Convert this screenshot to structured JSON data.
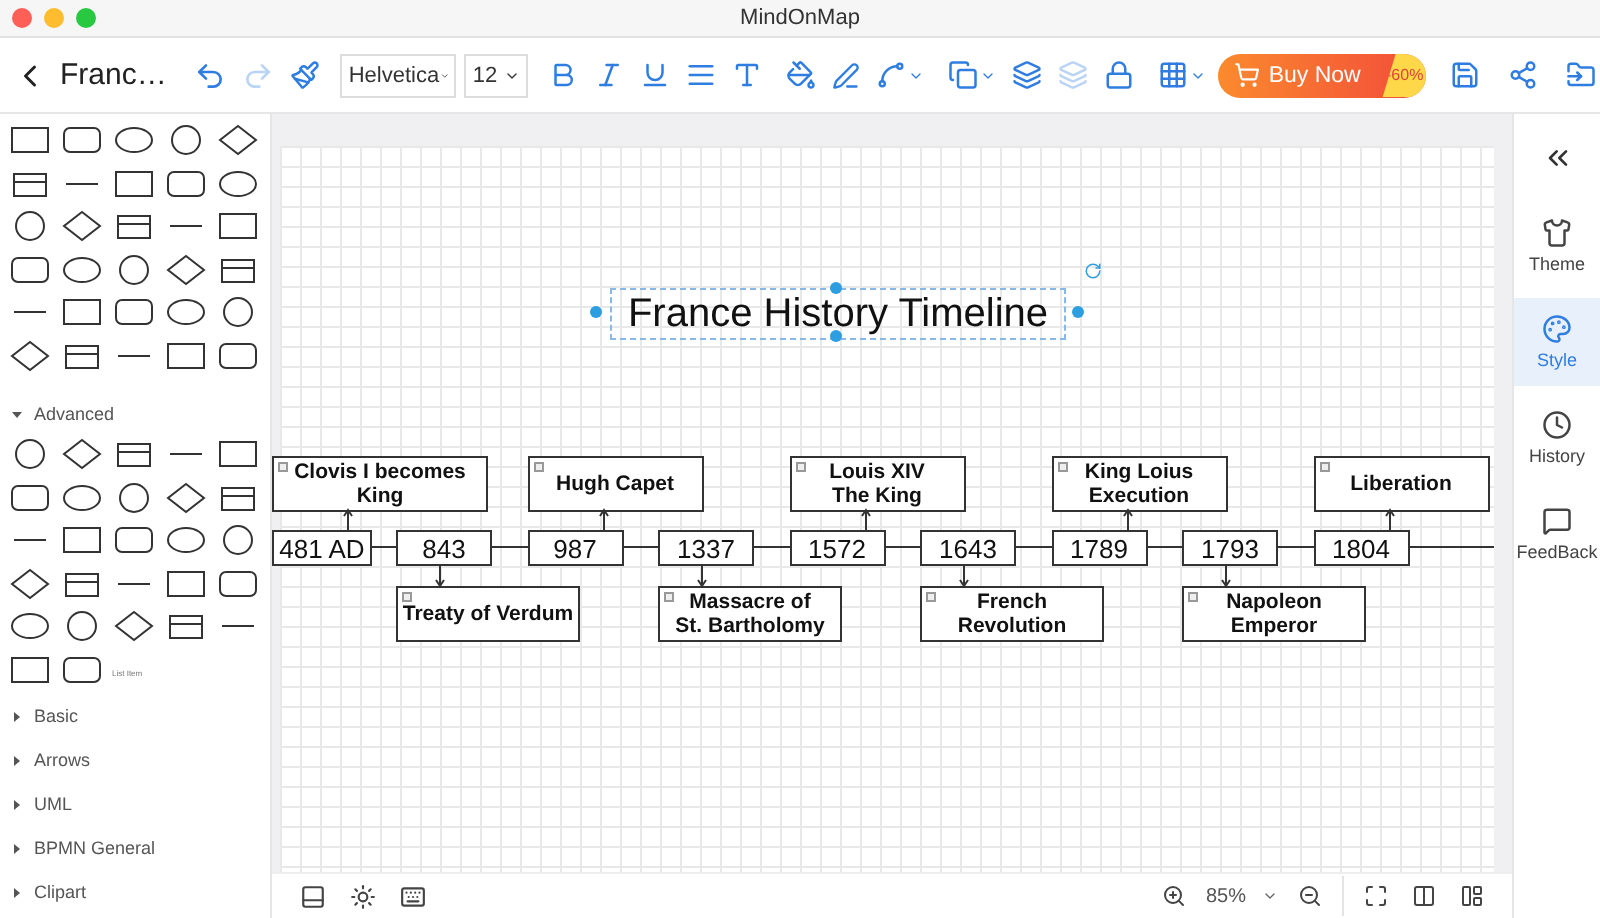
{
  "window": {
    "title": "MindOnMap"
  },
  "toolbar": {
    "document_title": "Franc…",
    "font": "Helvetica",
    "font_size": "12",
    "buy_button": "Buy Now",
    "discount": "-60%"
  },
  "shape_panel": {
    "list_item_label": "List Item",
    "sections": [
      {
        "label": "Advanced",
        "expanded": true
      },
      {
        "label": "Basic",
        "expanded": false
      },
      {
        "label": "Arrows",
        "expanded": false
      },
      {
        "label": "UML",
        "expanded": false
      },
      {
        "label": "BPMN General",
        "expanded": false
      },
      {
        "label": "Clipart",
        "expanded": false
      }
    ]
  },
  "canvas": {
    "title": {
      "text": "France History Timeline",
      "selected": true
    },
    "events": [
      {
        "year": "481 AD",
        "label": "Clovis I becomes\nKing",
        "above": true
      },
      {
        "year": "843",
        "label": "Treaty of Verdum",
        "above": false
      },
      {
        "year": "987",
        "label": "Hugh Capet",
        "above": true
      },
      {
        "year": "1337",
        "label": "Massacre of\nSt. Bartholomy",
        "above": false
      },
      {
        "year": "1572",
        "label": "Louis XIV\nThe King",
        "above": true
      },
      {
        "year": "1643",
        "label": "French\nRevolution",
        "above": false
      },
      {
        "year": "1789",
        "label": "King Loius\nExecution",
        "above": true
      },
      {
        "year": "1793",
        "label": "Napoleon\nEmperor",
        "above": false
      },
      {
        "year": "1804",
        "label": "Liberation",
        "above": true
      }
    ]
  },
  "right_sidebar": {
    "items": [
      {
        "label": "Theme",
        "kind": "theme",
        "selected": false
      },
      {
        "label": "Style",
        "kind": "style",
        "selected": true
      },
      {
        "label": "History",
        "kind": "history",
        "selected": false
      },
      {
        "label": "FeedBack",
        "kind": "feedback",
        "selected": false
      }
    ]
  },
  "status_bar": {
    "zoom": "85%"
  }
}
